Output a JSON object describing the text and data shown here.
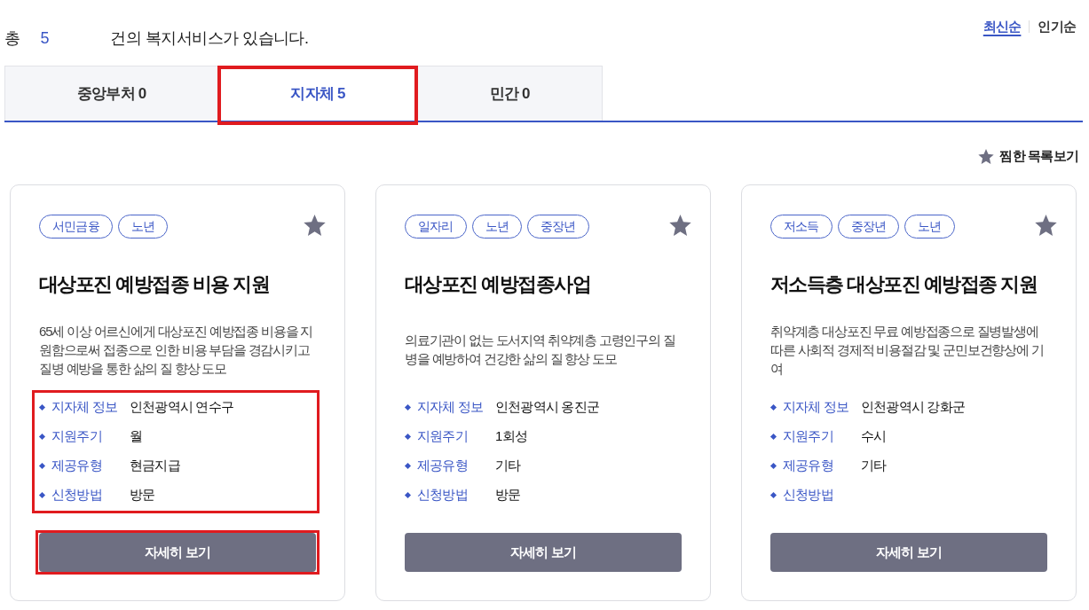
{
  "summary": {
    "prefix": "총",
    "count": "5",
    "suffix": "건의 복지서비스가 있습니다."
  },
  "sort_options": [
    {
      "label": "최신순",
      "selected": true
    },
    {
      "label": "인기순",
      "selected": false
    }
  ],
  "tabs": [
    {
      "label": "중앙부처 0",
      "selected": false,
      "highlighted": false
    },
    {
      "label": "지자체 5",
      "selected": true,
      "highlighted": true
    },
    {
      "label": "민간 0",
      "selected": false,
      "highlighted": false
    }
  ],
  "favorites_link": {
    "label": "찜한 목록보기"
  },
  "cards": [
    {
      "tags": [
        "서민금융",
        "노년"
      ],
      "title": "대상포진 예방접종 비용 지원",
      "description": "65세 이상 어르신에게 대상포진 예방접종 비용을 지원함으로써 접종으로 인한 비용 부담을 경감시키고 질병 예방을 통한 삶의 질 향상 도모",
      "info_highlighted": true,
      "info": [
        {
          "label": "지자체 정보",
          "value": "인천광역시 연수구"
        },
        {
          "label": "지원주기",
          "value": "월"
        },
        {
          "label": "제공유형",
          "value": "현금지급"
        },
        {
          "label": "신청방법",
          "value": "방문"
        }
      ],
      "button": {
        "label": "자세히 보기",
        "highlighted": true
      }
    },
    {
      "tags": [
        "일자리",
        "노년",
        "중장년"
      ],
      "title": "대상포진 예방접종사업",
      "description": "의료기관이 없는 도서지역 취약계층 고령인구의 질병을 예방하여 건강한 삶의 질 향상 도모",
      "info_highlighted": false,
      "info": [
        {
          "label": "지자체 정보",
          "value": "인천광역시 옹진군"
        },
        {
          "label": "지원주기",
          "value": "1회성"
        },
        {
          "label": "제공유형",
          "value": "기타"
        },
        {
          "label": "신청방법",
          "value": "방문"
        }
      ],
      "button": {
        "label": "자세히 보기",
        "highlighted": false
      }
    },
    {
      "tags": [
        "저소득",
        "중장년",
        "노년"
      ],
      "title": "저소득층 대상포진 예방접종 지원",
      "description": "취약계층 대상포진 무료 예방접종으로 질병발생에 따른 사회적 경제적 비용절감 및 군민보건향상에 기여",
      "info_highlighted": false,
      "info": [
        {
          "label": "지자체 정보",
          "value": "인천광역시 강화군"
        },
        {
          "label": "지원주기",
          "value": "수시"
        },
        {
          "label": "제공유형",
          "value": "기타"
        },
        {
          "label": "신청방법"
        }
      ],
      "button": {
        "label": "자세히 보기",
        "highlighted": false
      }
    }
  ]
}
